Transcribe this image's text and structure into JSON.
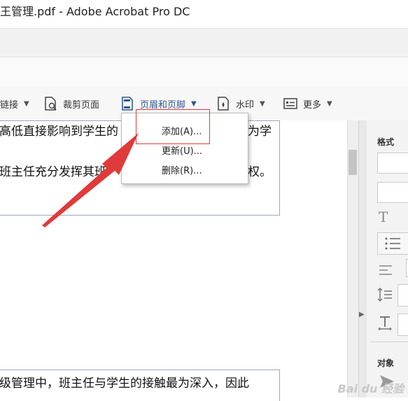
{
  "window": {
    "title": "王管理.pdf - Adobe Acrobat Pro DC"
  },
  "toolbar": {
    "link_label": "链接",
    "crop_label": "裁剪页面",
    "header_footer_label": "页眉和页脚",
    "watermark_label": "水印",
    "more_label": "更多"
  },
  "menu": {
    "add_label": "添加(A)...",
    "update_label": "更新(U)...",
    "delete_label": "删除(R)..."
  },
  "document": {
    "line1": "高低直接影响到学生的",
    "line1_right": "为学",
    "line2": "班主任充分发挥其班",
    "line2_right": "权。",
    "line3": "级管理中，班主任与学生的接触最为深入，因此"
  },
  "right_panel": {
    "format_label": "格式",
    "object_label": "对象"
  },
  "watermark": {
    "text": "Bai du 经验"
  },
  "colors": {
    "highlight": "#e03a3a",
    "arrow": "#e03a3a",
    "toolbar_bg": "#f7f7f7",
    "icon": "#2d5a8c"
  }
}
